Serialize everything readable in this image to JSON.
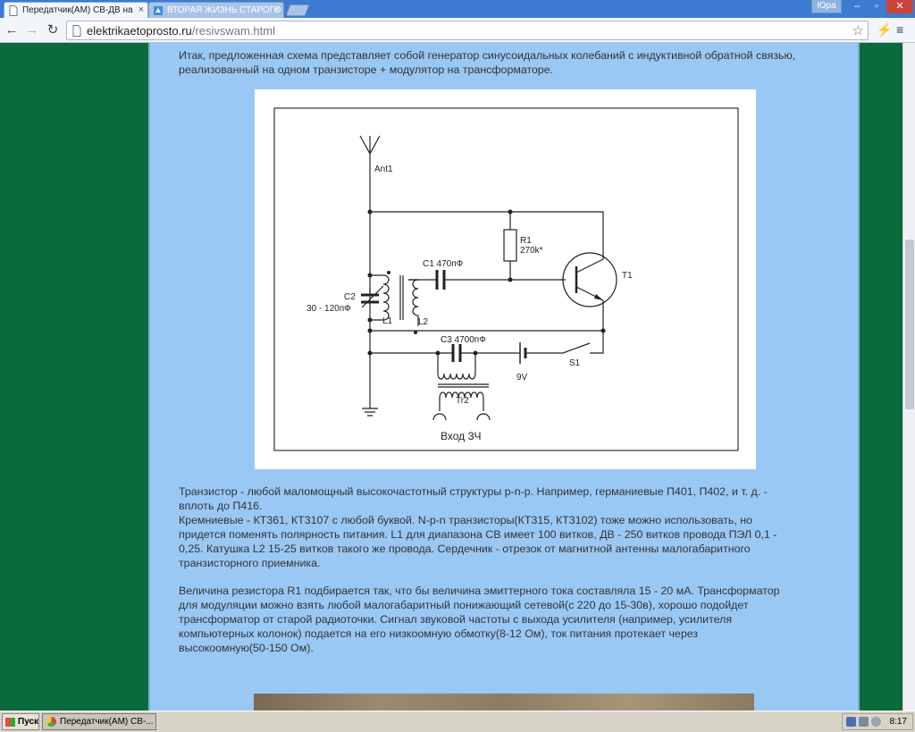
{
  "browser": {
    "tabs": [
      {
        "title": "Передатчик(АМ) СВ-ДВ на",
        "active": true
      },
      {
        "title": "ВТОРАЯ ЖИЗНЬ СТАРОГО Р",
        "active": false
      }
    ],
    "user": "Юра",
    "url_domain": "elektrikaetoprosto.ru",
    "url_path": "/resivswam.html"
  },
  "article": {
    "intro": "Итак, предложенная схема представляет собой генератор синусоидальных колебаний с индуктивной обратной связью, реализованный на одном транзисторе + модулятор на трансформаторе.",
    "para2_lines": [
      "Транзистор - любой маломощный высокочастотный структуры p-n-p. Например, германиевые П401, П402, и т. д. -",
      "вплоть до П416.",
      "Кремниевые - КТ361, КТ3107 с любой буквой. N-p-n транзисторы(КТ315, КТ3102) тоже можно использовать, но",
      "придется поменять полярность питания. L1 для диапазона СВ имеет 100 витков, ДВ - 250 витков провода ПЭЛ 0,1 -",
      "0,25. Катушка L2 15-25 витков такого же провода. Сердечник - отрезок от магнитной антенны малогабаритного",
      "транзисторного приемника."
    ],
    "para3_lines": [
      "Величина резистора R1 подбирается так, что бы величина эмиттерного тока составляла 15 - 20 мА. Трансформатор",
      "для модуляции можно взять любой малогабаритный понижающий сетевой(с 220 до 15-30в), хорошо подойдет",
      "трансформатор от старой радиоточки. Сигнал звуковой частоты с выхода усилителя (например, усилителя",
      "компьютерных колонок) подается на его низкоомную обмотку(8-12 Ом), ток питания протекает через",
      "высокоомную(50-150 Ом)."
    ]
  },
  "schematic": {
    "ant": "Ant1",
    "r1_name": "R1",
    "r1_value": "270k*",
    "c1": "C1 470пФ",
    "c2_name": "C2",
    "c2_value": "30 - 120пФ",
    "l1": "L1",
    "l2": "L2",
    "t1": "T1",
    "c3": "C3 4700пФ",
    "s1": "S1",
    "battery": "9V",
    "tr2": "Tr2",
    "input": "Вход ЗЧ"
  },
  "taskbar": {
    "start": "Пуск",
    "task": "Передатчик(АМ) СВ-...",
    "clock": "8:17"
  },
  "icons": {
    "back": "arrow-left",
    "forward": "arrow-right",
    "reload": "reload",
    "star": "star",
    "menu": "wrench"
  }
}
